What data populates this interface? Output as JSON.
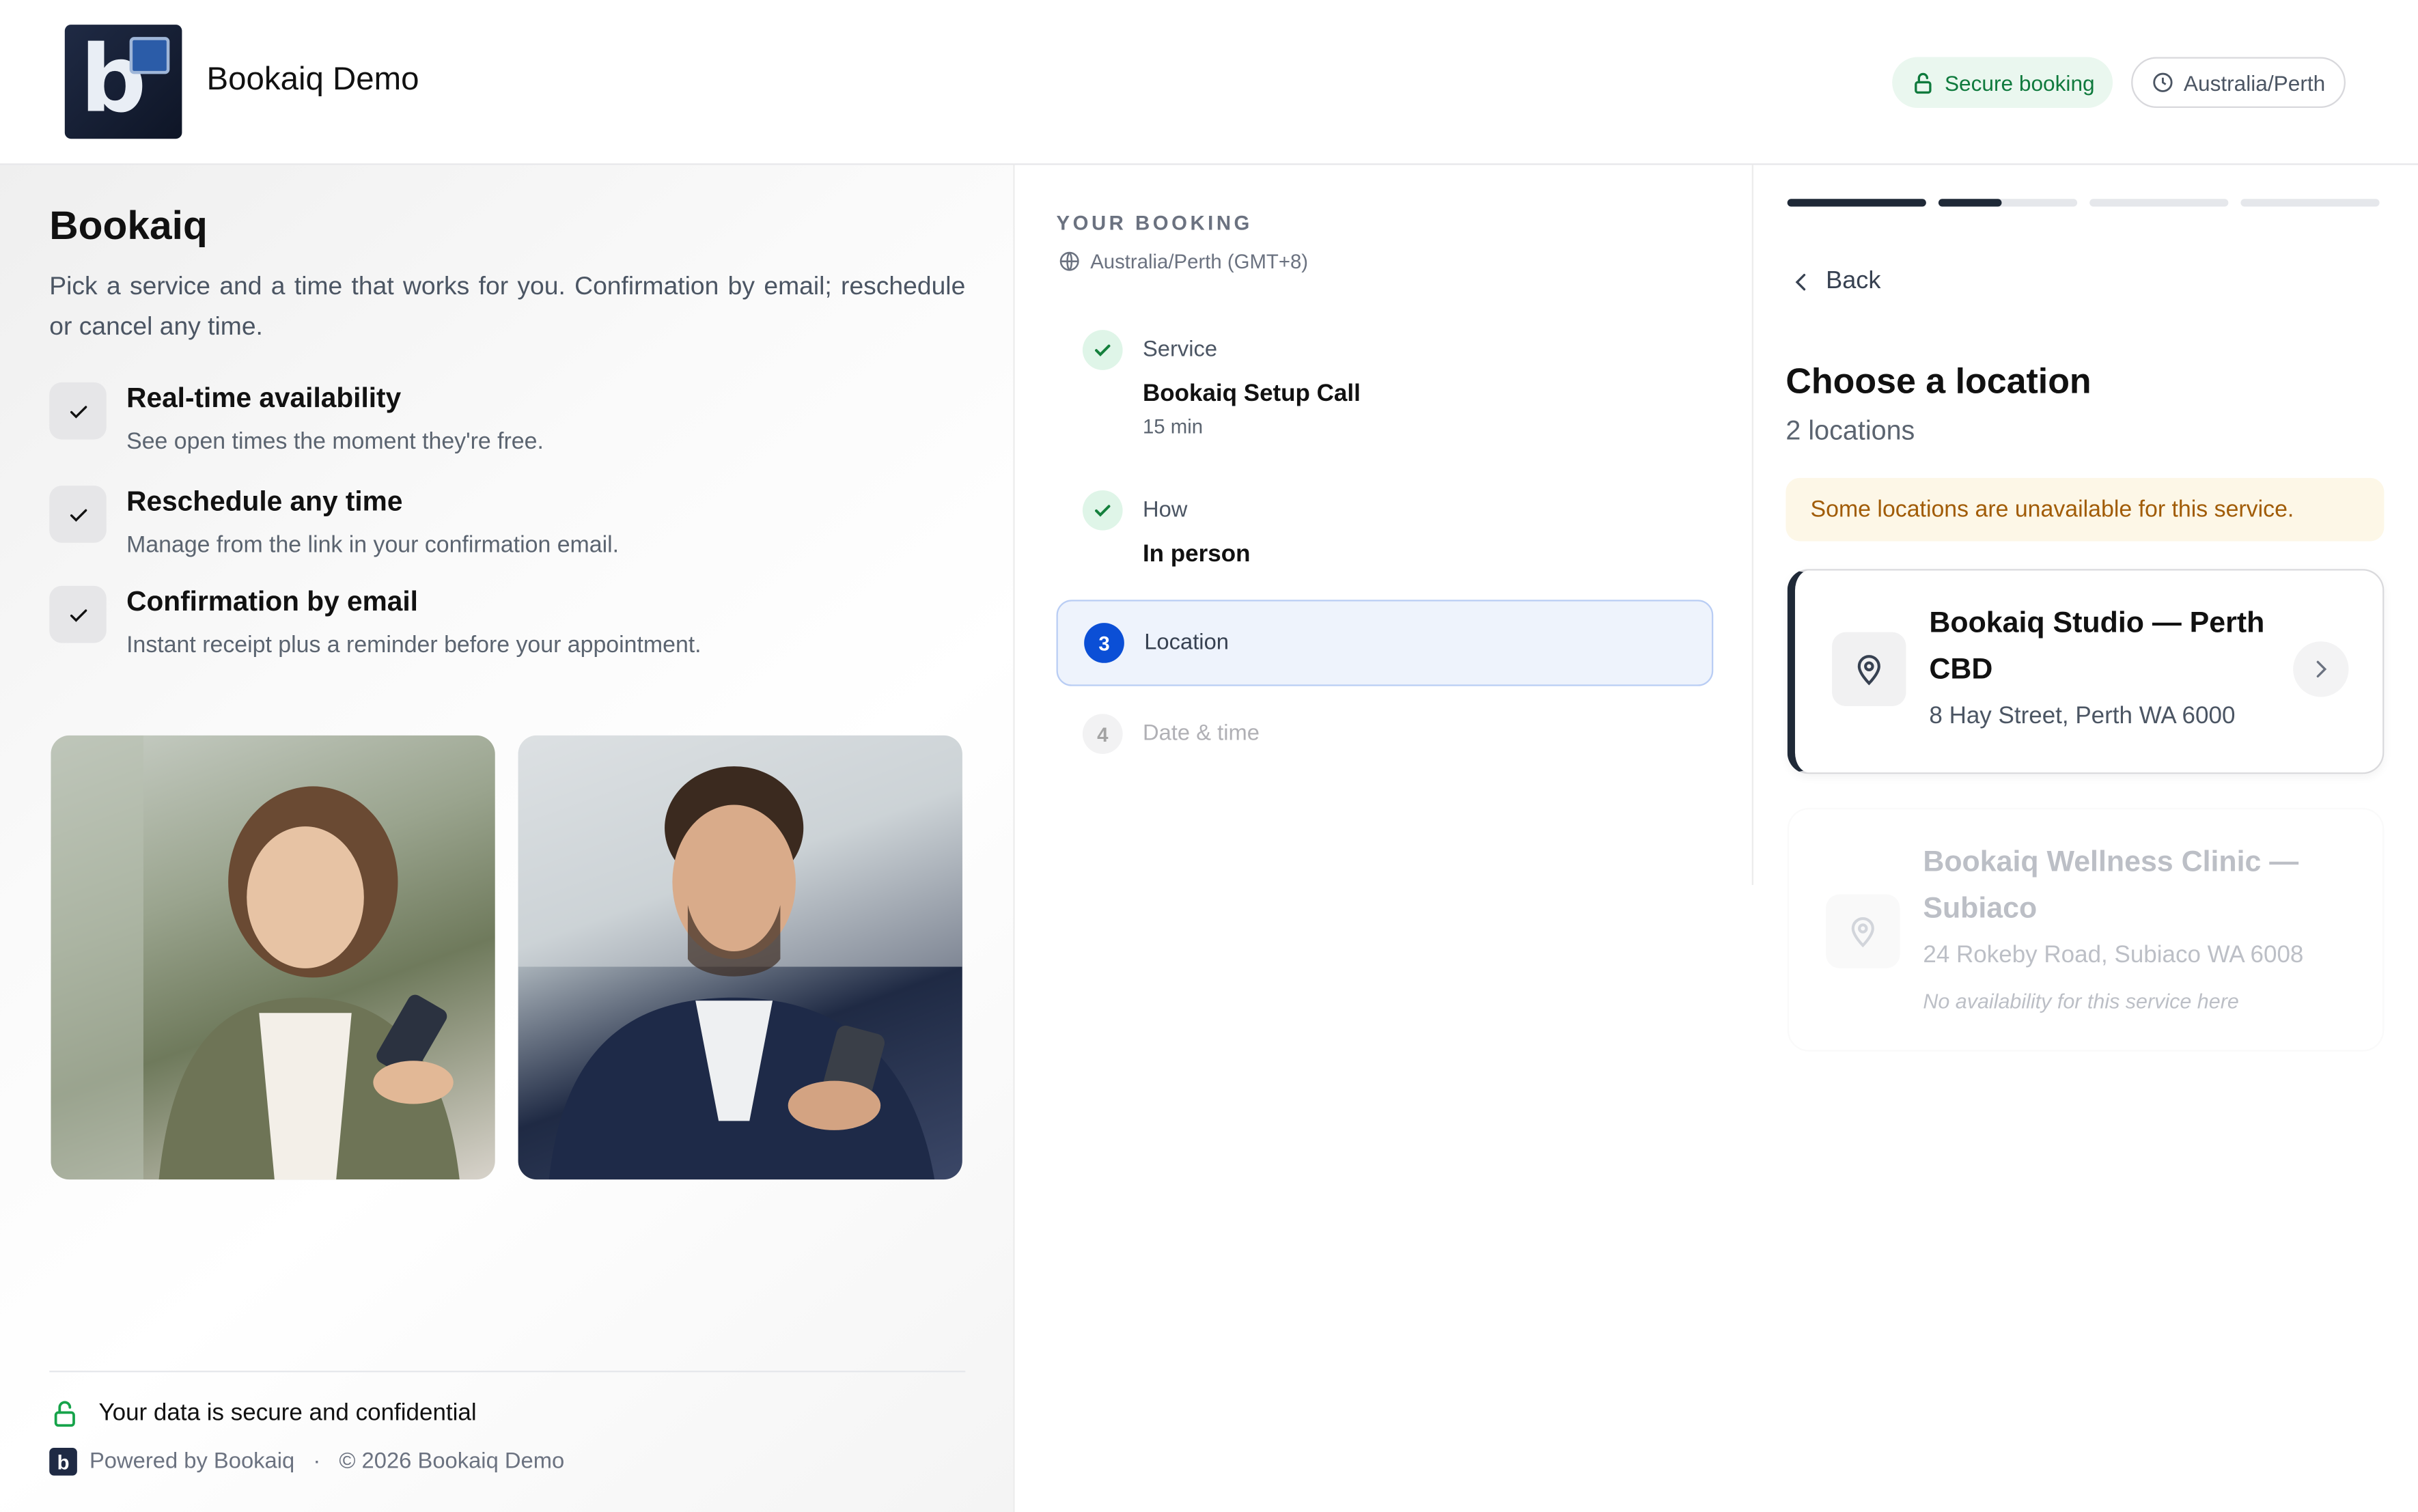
{
  "header": {
    "brand_name": "Bookaiq Demo",
    "secure_label": "Secure booking",
    "timezone_label": "Australia/Perth"
  },
  "intro": {
    "title": "Bookaiq",
    "description": "Pick a service and a time that works for you. Confirmation by email; reschedule or cancel any time.",
    "features": [
      {
        "title": "Real-time availability",
        "desc": "See open times the moment they're free."
      },
      {
        "title": "Reschedule any time",
        "desc": "Manage from the link in your confirmation email."
      },
      {
        "title": "Confirmation by email",
        "desc": "Instant receipt plus a reminder before your appointment."
      }
    ],
    "secure_note": "Your data is secure and confidential",
    "powered_by": "Powered by Bookaiq",
    "separator": "·",
    "copyright": "© 2026 Bookaiq Demo"
  },
  "summary": {
    "heading": "YOUR BOOKING",
    "timezone": "Australia/Perth (GMT+8)",
    "steps": [
      {
        "label": "Service",
        "value": "Bookaiq Setup Call",
        "sub": "15 min",
        "state": "done"
      },
      {
        "label": "How",
        "value": "In person",
        "state": "done"
      },
      {
        "label": "Location",
        "number": "3",
        "state": "current"
      },
      {
        "label": "Date & time",
        "number": "4",
        "state": "todo"
      }
    ]
  },
  "location_step": {
    "progress": [
      1,
      0.45,
      0,
      0
    ],
    "back_label": "Back",
    "title": "Choose a location",
    "count": "2 locations",
    "warning": "Some locations are unavailable for this service.",
    "locations": [
      {
        "name": "Bookaiq Studio — Perth CBD",
        "address": "8 Hay Street, Perth WA 6000",
        "available": true
      },
      {
        "name": "Bookaiq Wellness Clinic — Subiaco",
        "address": "24 Rokeby Road, Subiaco WA 6008",
        "note": "No availability for this service here",
        "available": false
      }
    ]
  },
  "colors": {
    "accent": "#0b4fd6",
    "success": "#15803d",
    "warning_text": "#a15c07",
    "warning_bg": "#fdf7e7"
  }
}
